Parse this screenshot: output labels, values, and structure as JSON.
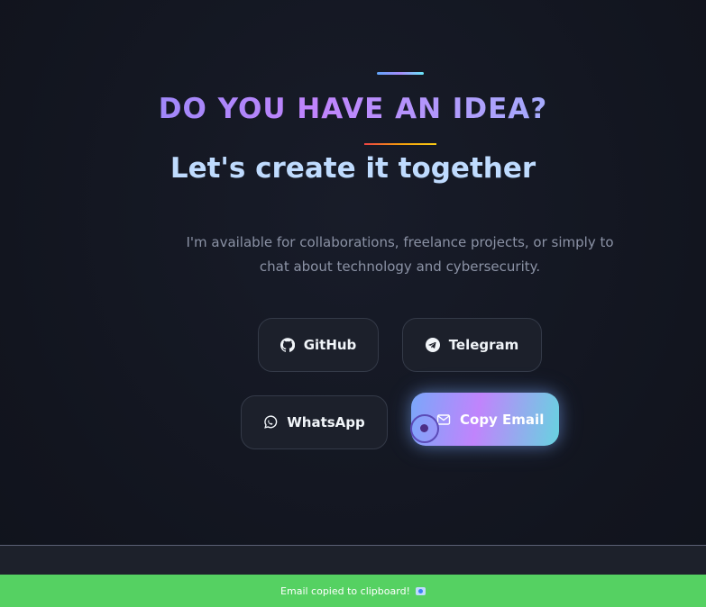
{
  "hero": {
    "title": "DO YOU HAVE AN IDEA?",
    "subtitle": "Let's create it together",
    "description": "I'm available for collaborations, freelance projects, or simply to chat about technology and cybersecurity."
  },
  "contact": {
    "github_label": "GitHub",
    "telegram_label": "Telegram",
    "whatsapp_label": "WhatsApp",
    "copy_email_label": "Copy Email",
    "icons": {
      "github": "github-icon",
      "telegram": "telegram-icon",
      "whatsapp": "whatsapp-icon",
      "email": "mail-icon"
    }
  },
  "toast": {
    "message": "Email copied to clipboard!"
  },
  "colors": {
    "background": "#131621",
    "button_bg": "#1c202b",
    "toast_bg": "#55d162",
    "title_gradient_start": "#818cf8",
    "title_gradient_end": "#93c5fd",
    "subtitle": "#bfdbfe"
  }
}
